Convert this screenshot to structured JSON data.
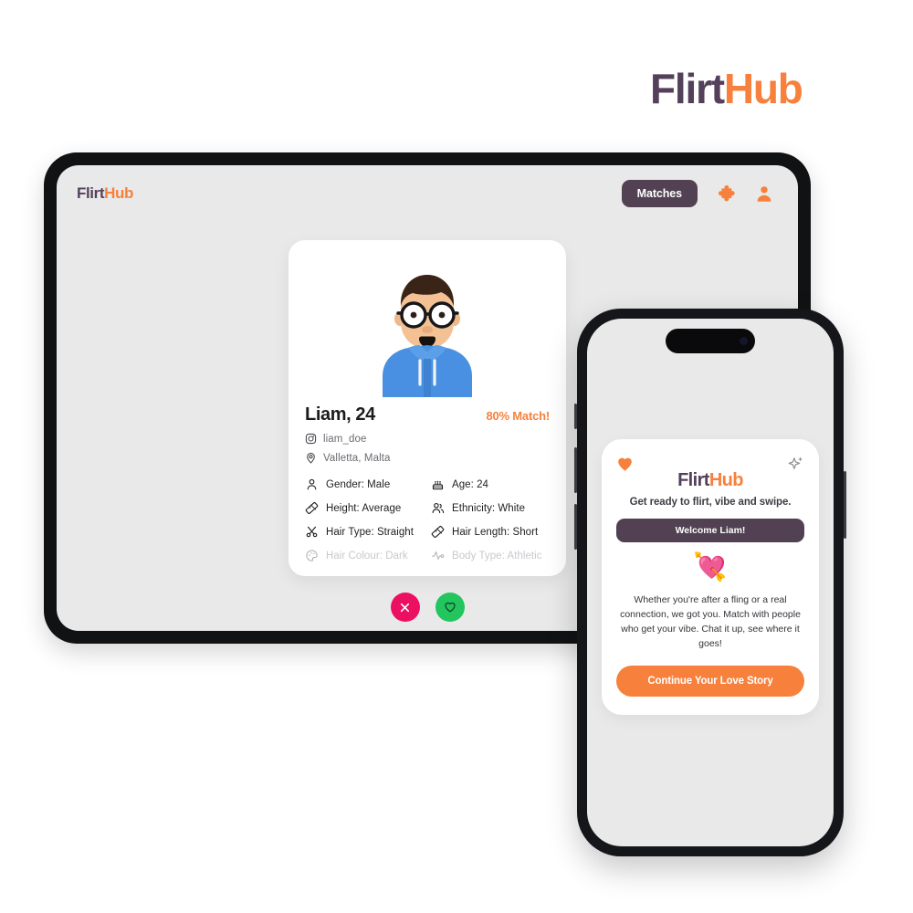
{
  "brand": {
    "part1": "Flirt",
    "part2": "Hub",
    "color_dark": "#54405a",
    "color_accent": "#f7813c"
  },
  "tablet": {
    "logo": {
      "part1": "Flirt",
      "part2": "Hub"
    },
    "header": {
      "matches_label": "Matches",
      "icons": [
        "puzzle-piece-icon",
        "user-profile-icon"
      ]
    },
    "profile_card": {
      "avatar_alt": "illustrated-male-avatar-glasses-blue-hoodie",
      "name": "Liam, 24",
      "match": "80% Match!",
      "username": "liam_doe",
      "location": "Valletta, Malta",
      "attributes": [
        {
          "icon": "person-icon",
          "text": "Gender: Male",
          "dim": false
        },
        {
          "icon": "cake-icon",
          "text": "Age: 24",
          "dim": false
        },
        {
          "icon": "ruler-icon",
          "text": "Height: Average",
          "dim": false
        },
        {
          "icon": "people-icon",
          "text": "Ethnicity: White",
          "dim": false
        },
        {
          "icon": "scissors-icon",
          "text": "Hair Type: Straight",
          "dim": false
        },
        {
          "icon": "ruler-icon",
          "text": "Hair Length: Short",
          "dim": false
        },
        {
          "icon": "palette-icon",
          "text": "Hair Colour: Dark",
          "dim": true
        },
        {
          "icon": "activity-icon",
          "text": "Body Type: Athletic",
          "dim": true
        }
      ]
    },
    "actions": {
      "nope_icon": "close-x-icon",
      "nope_color": "#ec1062",
      "like_icon": "heart-outline-icon",
      "like_color": "#22c55e"
    }
  },
  "phone": {
    "card": {
      "heart_icon": "heart-filled-icon",
      "sparkle_icon": "sparkle-icon",
      "logo": {
        "part1": "Flirt",
        "part2": "Hub"
      },
      "tagline": "Get ready to flirt, vibe and swipe.",
      "welcome_banner": "Welcome Liam!",
      "emoji": "💘",
      "body_text": "Whether you're after a fling or a real connection, we got you. Match with people who get your vibe. Chat it up, see where it goes!",
      "cta_label": "Continue Your Love Story"
    }
  }
}
